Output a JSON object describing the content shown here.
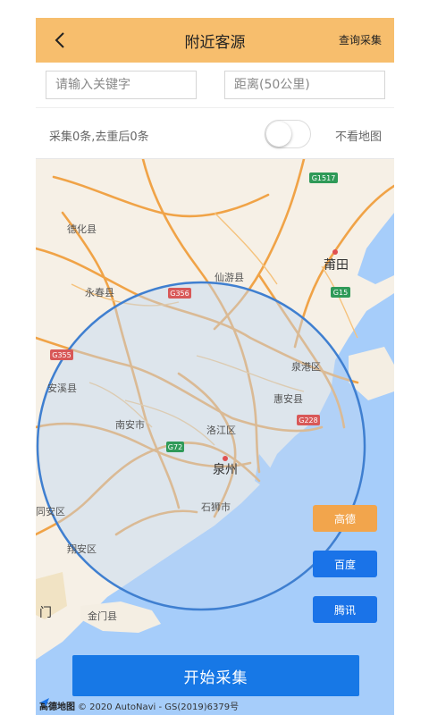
{
  "header": {
    "title": "附近客源",
    "action_label": "查询采集"
  },
  "search": {
    "keyword_placeholder": "请输入关键字",
    "distance_placeholder": "距离(50公里)"
  },
  "stats": {
    "summary": "采集0条,去重后0条",
    "toggle_label": "不看地图",
    "toggle_on": false
  },
  "map": {
    "places": {
      "dehua": "德化县",
      "yongchun": "永春县",
      "xianyou": "仙游县",
      "putian": "莆田",
      "anxi": "安溪县",
      "quangang": "泉港区",
      "huian": "惠安县",
      "nanan": "南安市",
      "luojiang": "洛江区",
      "quanzhou": "泉州",
      "shishi": "石狮市",
      "tongan": "同安区",
      "xiangan": "翔安区",
      "jinmen": "金门县",
      "xiamen": "门"
    },
    "roads": [
      "G1517",
      "G356",
      "G15",
      "G355",
      "G228",
      "G72"
    ],
    "radius_km": 50,
    "colors": {
      "circle_stroke": "#3f7fd0",
      "road": "#f0a347",
      "sea": "#a6cdfa"
    },
    "attribution": {
      "logo": "高德地图",
      "copyright": "© 2020 AutoNavi - GS(2019)6379号"
    }
  },
  "providers": {
    "gaode": "高德",
    "baidu": "百度",
    "tencent": "腾讯",
    "active": "gaode"
  },
  "actions": {
    "start_label": "开始采集"
  }
}
